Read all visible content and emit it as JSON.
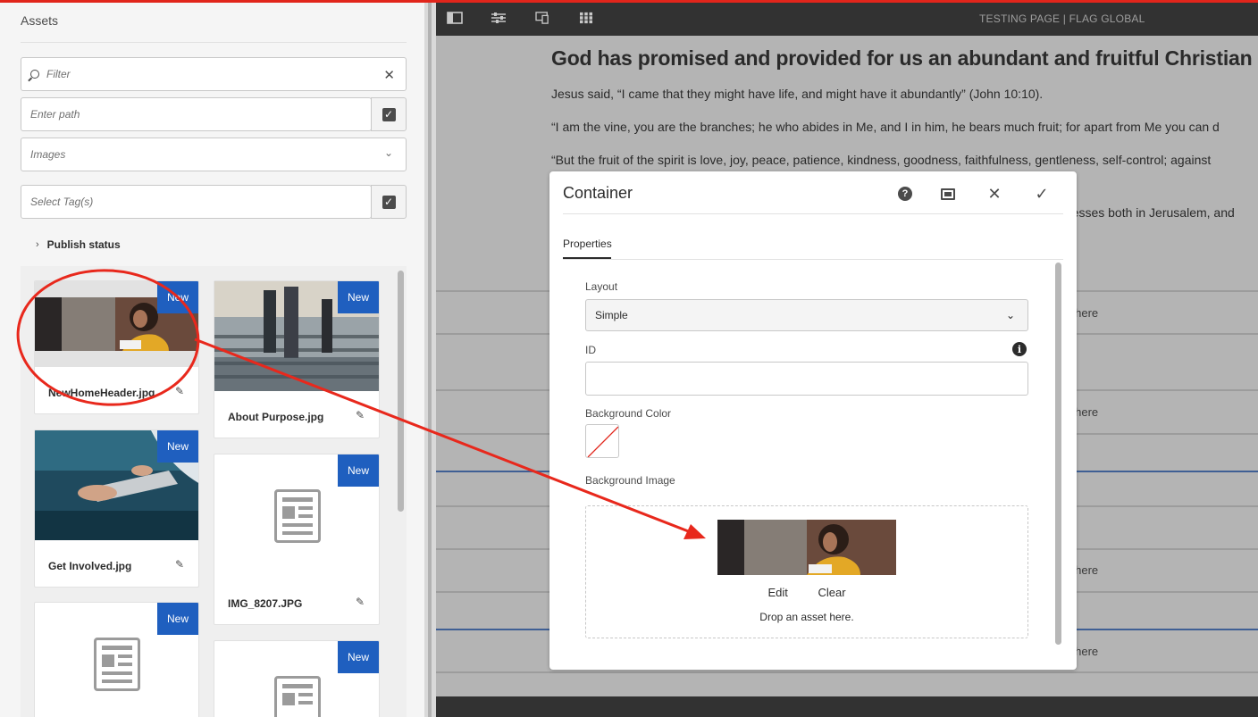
{
  "panel": {
    "title": "Assets",
    "filter_placeholder": "Filter",
    "path_placeholder": "Enter path",
    "type_value": "Images",
    "tags_placeholder": "Select Tag(s)",
    "publish_status": "Publish status"
  },
  "assets": [
    {
      "name": "NewHomeHeader.jpg",
      "badge": "New",
      "thumb": "woman-photo"
    },
    {
      "name": "About Purpose.jpg",
      "badge": "New",
      "thumb": "stairs-photo"
    },
    {
      "name": "Get Involved.jpg",
      "badge": "New",
      "thumb": "tablet-photo"
    },
    {
      "name": "IMG_8207.JPG",
      "badge": "New",
      "thumb": "document-placeholder"
    },
    {
      "name": "",
      "badge": "New",
      "thumb": "document-placeholder"
    },
    {
      "name": "",
      "badge": "New",
      "thumb": "document-placeholder"
    }
  ],
  "toolbar": {
    "page_title": "TESTING PAGE | FLAG GLOBAL",
    "icons": [
      "side-panel-icon",
      "properties-icon",
      "emulator-icon",
      "grid-icon"
    ]
  },
  "page": {
    "heading": "God has promised and provided for us an abundant and fruitful Christian lif",
    "paragraphs": [
      "Jesus said, “I came that they might have life, and might have it abundantly” (John 10:10).",
      "“I am the vine, you are the branches; he who abides in Me, and I in him, he bears much fruit; for apart from Me you can d",
      "“But the fruit of the spirit is love, joy, peace, patience, kindness, goodness, faithfulness, gentleness, self-control; against",
      "tnesses both in Jerusalem, and"
    ],
    "drop_snippets": [
      "s here",
      "s here",
      "s here",
      "s here"
    ]
  },
  "dialog": {
    "title": "Container",
    "tab": "Properties",
    "layout_label": "Layout",
    "layout_value": "Simple",
    "id_label": "ID",
    "id_value": "",
    "bg_color_label": "Background Color",
    "bg_image_label": "Background Image",
    "edit_label": "Edit",
    "clear_label": "Clear",
    "drop_hint": "Drop an asset here."
  },
  "colors": {
    "badge": "#1f5fbf",
    "annotation": "#e8281c",
    "toolbar": "#323232"
  }
}
